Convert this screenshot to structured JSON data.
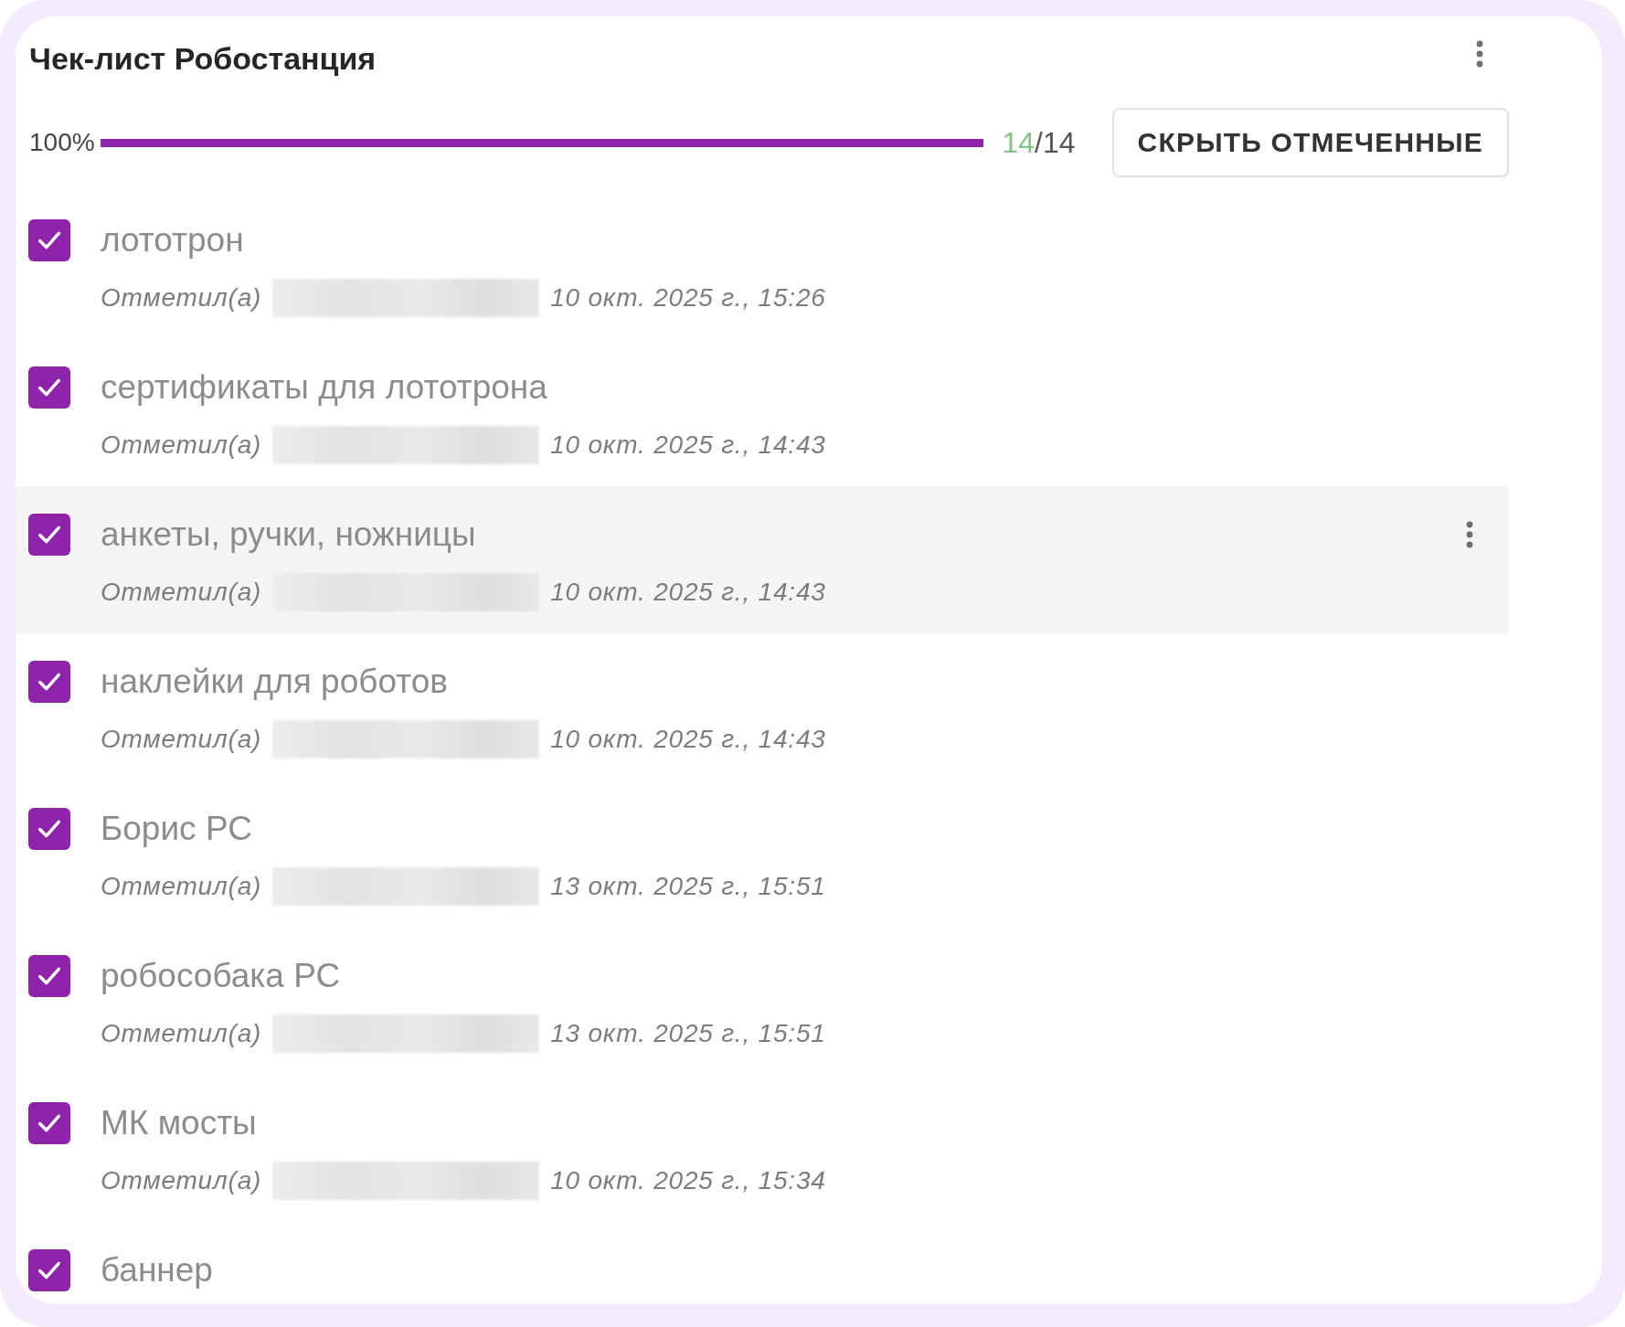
{
  "checklist": {
    "title": "Чек-лист Робостанция"
  },
  "progress": {
    "percent": "100%",
    "level": 1,
    "done": "14",
    "total": "/14"
  },
  "hide_checked_button": {
    "label": "СКРЫТЬ ОТМЕЧЕННЫЕ"
  },
  "items": [
    {
      "label": "лототрон",
      "checked": true,
      "hovered": false,
      "meta": {
        "prefix": "Отметил(а)",
        "name_blurred": true,
        "date": "10 окт. 2025 г., 15:26"
      }
    },
    {
      "label": "сертификаты для лототрона",
      "checked": true,
      "hovered": false,
      "meta": {
        "prefix": "Отметил(а)",
        "name_blurred": true,
        "date": "10 окт. 2025 г., 14:43"
      }
    },
    {
      "label": "анкеты, ручки, ножницы",
      "checked": true,
      "hovered": true,
      "meta": {
        "prefix": "Отметил(а)",
        "name_blurred": true,
        "date": "10 окт. 2025 г., 14:43"
      }
    },
    {
      "label": "наклейки для роботов",
      "checked": true,
      "hovered": false,
      "meta": {
        "prefix": "Отметил(а)",
        "name_blurred": true,
        "date": "10 окт. 2025 г., 14:43"
      }
    },
    {
      "label": "Борис РС",
      "checked": true,
      "hovered": false,
      "meta": {
        "prefix": "Отметил(а)",
        "name_blurred": true,
        "date": "13 окт. 2025 г., 15:51"
      }
    },
    {
      "label": "робособака РС",
      "checked": true,
      "hovered": false,
      "meta": {
        "prefix": "Отметил(а)",
        "name_blurred": true,
        "date": "13 окт. 2025 г., 15:51"
      }
    },
    {
      "label": "МК мосты",
      "checked": true,
      "hovered": false,
      "meta": {
        "prefix": "Отметил(а)",
        "name_blurred": true,
        "date": "10 окт. 2025 г., 15:34"
      }
    },
    {
      "label": "баннер",
      "checked": true,
      "hovered": false
    }
  ]
}
